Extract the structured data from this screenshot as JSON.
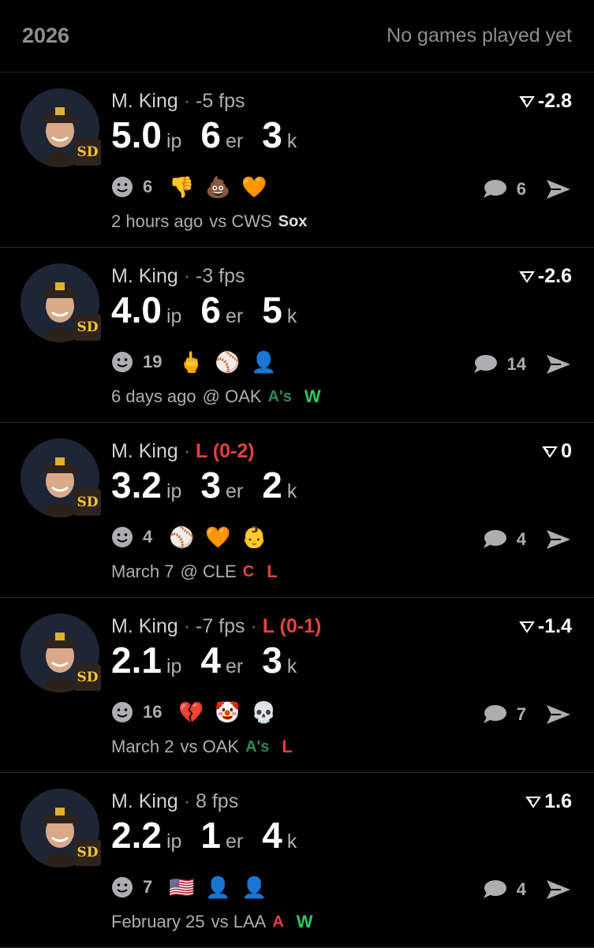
{
  "header": {
    "season": "2026",
    "status": "No games played yet"
  },
  "colors": {
    "win": "#30c85e",
    "loss": "#e5413f",
    "padres_gold": "#f2c233"
  },
  "games": [
    {
      "player": "M. King",
      "detail": "-5 fps",
      "decision": "",
      "ip": "5.0",
      "ip_unit": "ip",
      "er": "6",
      "er_unit": "er",
      "k": "3",
      "k_unit": "k",
      "rating": "-2.8",
      "reaction_count": "6",
      "comment_count": "6",
      "time": "2 hours ago",
      "matchup": "vs CWS",
      "opponent_logo": "white-sox-logo",
      "result": "",
      "reactions": [
        "thumbs-down-emoji",
        "poop-emoji",
        "mascot-sticker"
      ]
    },
    {
      "player": "M. King",
      "detail": "-3 fps",
      "decision": "",
      "ip": "4.0",
      "ip_unit": "ip",
      "er": "6",
      "er_unit": "er",
      "k": "5",
      "k_unit": "k",
      "rating": "-2.6",
      "reaction_count": "19",
      "comment_count": "14",
      "time": "6 days ago",
      "matchup": "@ OAK",
      "opponent_logo": "athletics-logo",
      "result": "W",
      "reactions": [
        "middle-finger-emoji",
        "player-sticker",
        "person-sticker"
      ]
    },
    {
      "player": "M. King",
      "detail": "",
      "decision": "L (0-2)",
      "ip": "3.2",
      "ip_unit": "ip",
      "er": "3",
      "er_unit": "er",
      "k": "2",
      "k_unit": "k",
      "rating": "0",
      "reaction_count": "4",
      "comment_count": "4",
      "time": "March 7",
      "matchup": "@ CLE",
      "opponent_logo": "guardians-logo",
      "result": "L",
      "reactions": [
        "player-sticker",
        "mascot-sticker",
        "baby-sticker"
      ]
    },
    {
      "player": "M. King",
      "detail": "-7 fps",
      "decision": "L (0-1)",
      "ip": "2.1",
      "ip_unit": "ip",
      "er": "4",
      "er_unit": "er",
      "k": "3",
      "k_unit": "k",
      "rating": "-1.4",
      "reaction_count": "16",
      "comment_count": "7",
      "time": "March 2",
      "matchup": "vs OAK",
      "opponent_logo": "athletics-logo",
      "result": "L",
      "reactions": [
        "broken-heart-emoji",
        "clown-emoji",
        "skull-emoji"
      ]
    },
    {
      "player": "M. King",
      "detail": "8 fps",
      "decision": "",
      "ip": "2.2",
      "ip_unit": "ip",
      "er": "1",
      "er_unit": "er",
      "k": "4",
      "k_unit": "k",
      "rating": "1.6",
      "reaction_count": "7",
      "comment_count": "4",
      "time": "February 25",
      "matchup": "vs LAA",
      "opponent_logo": "angels-logo",
      "result": "W",
      "reactions": [
        "us-flag-emoji",
        "person-sticker",
        "person-sticker"
      ]
    }
  ]
}
